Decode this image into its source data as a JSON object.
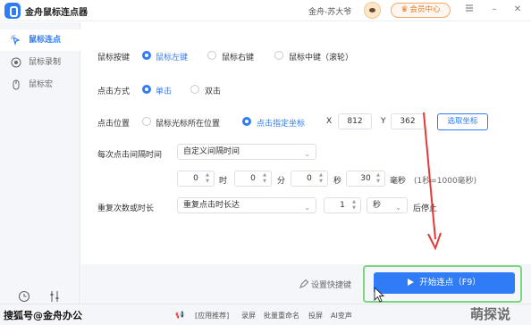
{
  "title_bar": {
    "app_title": "金舟鼠标连点器",
    "username": "金舟-苏大爷",
    "member_button": "会员中心",
    "minimize": "–",
    "close": "✕"
  },
  "sidebar": {
    "items": [
      {
        "label": "鼠标连点",
        "active": true
      },
      {
        "label": "鼠标录制",
        "active": false
      },
      {
        "label": "鼠标宏",
        "active": false
      }
    ],
    "tools": [
      {
        "label": "定时"
      },
      {
        "label": "设置"
      }
    ]
  },
  "mouse_button": {
    "label": "鼠标按键",
    "options": [
      "鼠标左键",
      "鼠标右键",
      "鼠标中键（滚轮）"
    ],
    "selected": "鼠标左键"
  },
  "click_mode": {
    "label": "点击方式",
    "options": [
      "单击",
      "双击"
    ],
    "selected": "单击"
  },
  "click_position": {
    "label": "点击位置",
    "options": [
      "鼠标光标所在位置",
      "点击指定坐标"
    ],
    "selected": "点击指定坐标",
    "x_label": "X",
    "x_value": "812",
    "y_label": "Y",
    "y_value": "362",
    "pick_button": "选取坐标"
  },
  "interval": {
    "label": "每次点击间隔时间",
    "mode": "自定义间隔时间",
    "hours": "0",
    "hours_unit": "时",
    "minutes": "0",
    "minutes_unit": "分",
    "seconds": "0",
    "seconds_unit": "秒",
    "milliseconds": "30",
    "ms_unit": "毫秒",
    "hint": "(1秒=1000毫秒)"
  },
  "repeat": {
    "label": "重复次数或时长",
    "mode": "重复点击时长达",
    "count": "1",
    "unit": "秒",
    "suffix": "后停止"
  },
  "bottom": {
    "hotkey_label": "设置快捷键",
    "start_button": "开始连点（F9）"
  },
  "footer": {
    "links": [
      "[应用推荐]",
      "录屏",
      "批量重命名",
      "投屏",
      "AI变声"
    ],
    "watermark_left": "搜狐号@金舟办公",
    "watermark_right": "萌探说"
  },
  "colors": {
    "accent": "#2f7cf6",
    "annotation_arrow": "#e53935",
    "highlight_frame": "#7bd67e"
  }
}
